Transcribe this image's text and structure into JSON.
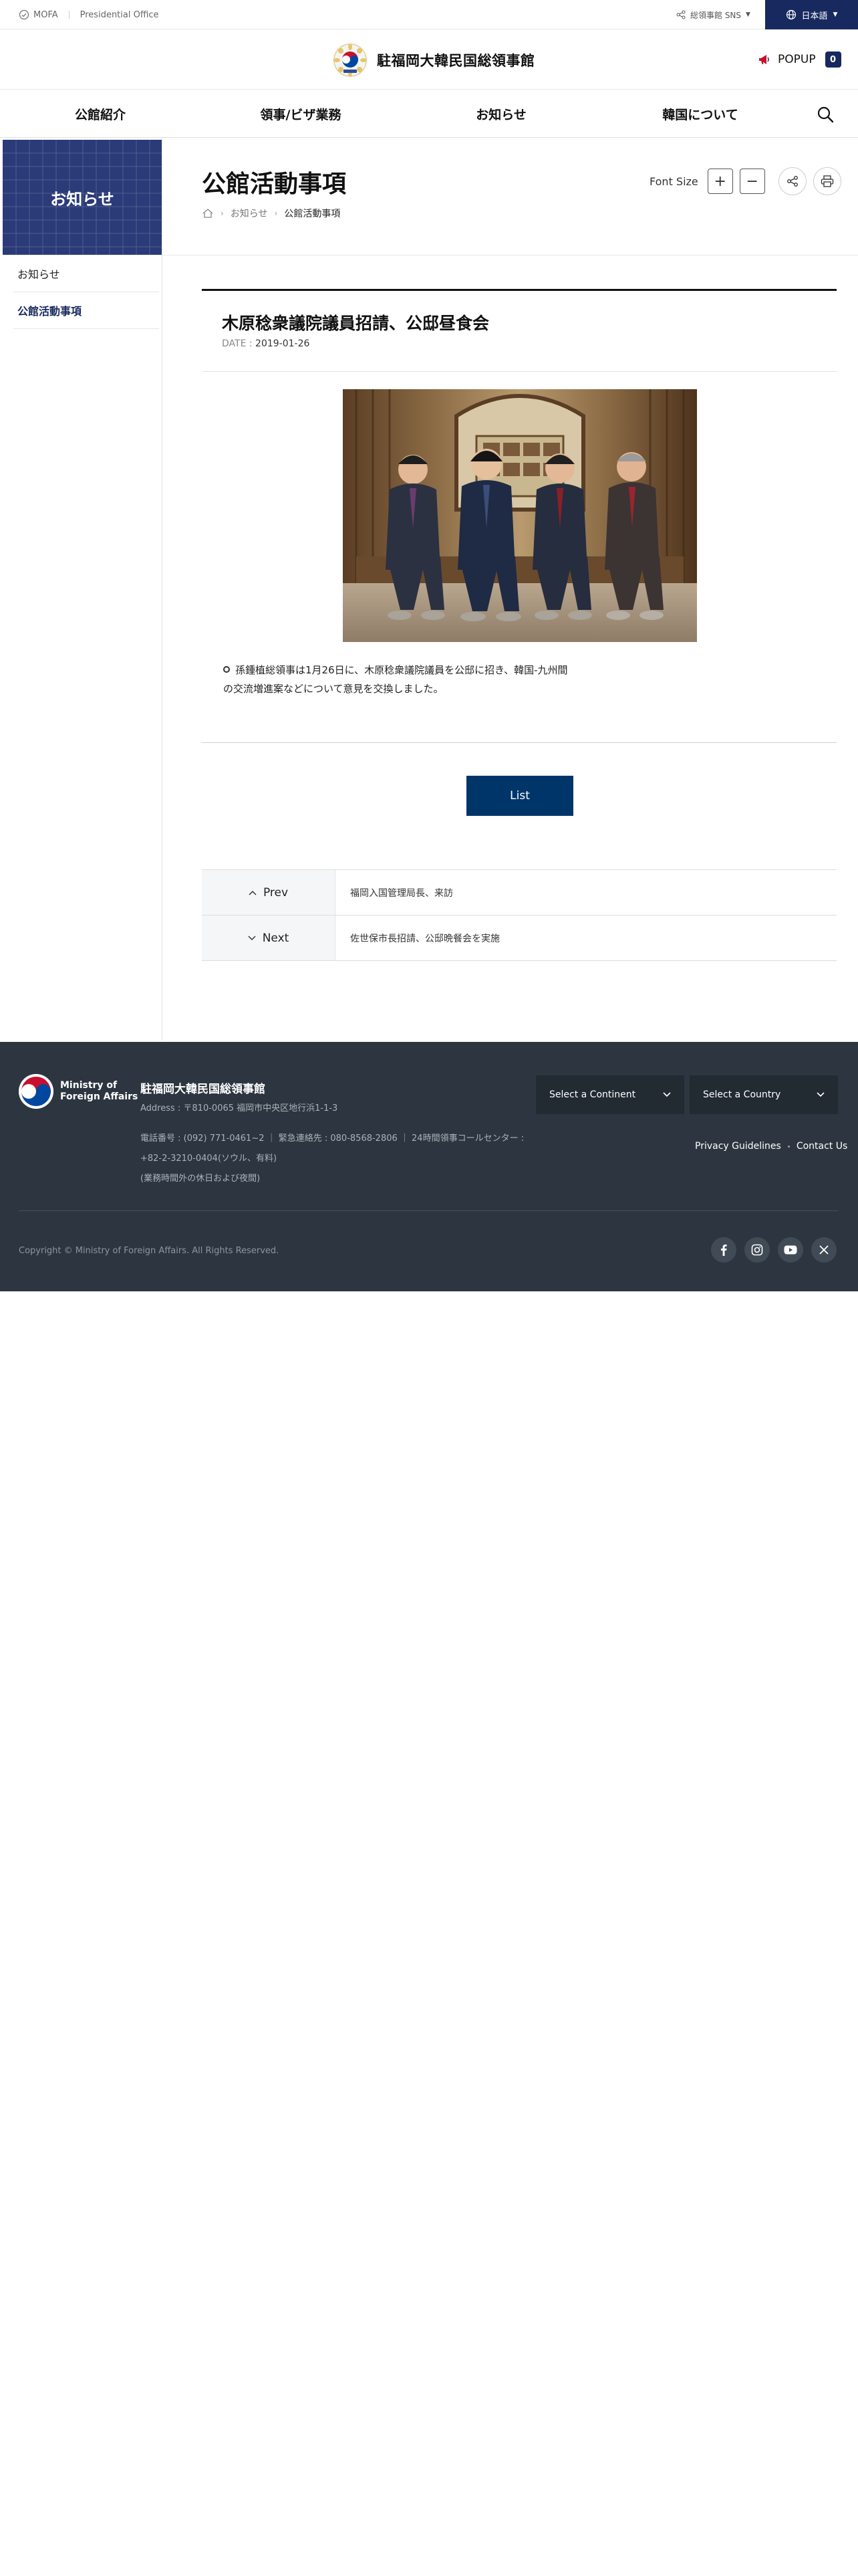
{
  "topbar": {
    "mofa_label": "MOFA",
    "presidential_label": "Presidential Office",
    "sns_label": "総領事館 SNS",
    "lang_label": "日本語"
  },
  "header": {
    "site_title": "駐福岡大韓民国総領事館",
    "popup_label": "POPUP",
    "popup_count": "0"
  },
  "gnb": {
    "items": [
      "公館紹介",
      "領事/ビザ業務",
      "お知らせ",
      "韓国について"
    ]
  },
  "sidebar": {
    "heading": "お知らせ",
    "items": [
      {
        "label": "お知らせ",
        "active": false
      },
      {
        "label": "公館活動事項",
        "active": true
      }
    ]
  },
  "page": {
    "title": "公館活動事項",
    "breadcrumb": [
      "お知らせ",
      "公館活動事項"
    ],
    "font_size_label": "Font Size",
    "plus_symbol": "+",
    "minus_symbol": "−"
  },
  "article": {
    "title": "木原稔衆議院議員招請、公邸昼食会",
    "date_label": "DATE :",
    "date_value": "2019-01-26",
    "body": "孫鍾植総領事は1月26日に、木原稔衆議院議員を公邸に招き、韓国-九州間の交流増進案などについて意見を交換しました。",
    "list_button": "List"
  },
  "prevnext": {
    "prev_label": "Prev",
    "prev_title": "福岡入国管理局長、来訪",
    "next_label": "Next",
    "next_title": "佐世保市長招請、公邸晩餐会を実施"
  },
  "footer": {
    "mfa_logo_line1": "Ministry of",
    "mfa_logo_line2": "Foreign Affairs",
    "name": "駐福岡大韓民国総領事館",
    "address": "Address : 〒810-0065 福岡市中央区地行浜1-1-3",
    "tel_line1": "電話番号 : (092) 771-0461~2 ｜ 緊急連絡先 : 080-8568-2806 ｜ 24時間領事コールセンター :",
    "tel_line2": "+82-2-3210-0404(ソウル、有料)",
    "tel_line3": "(業務時間外の休日および夜間)",
    "select_continent": "Select a Continent",
    "select_country": "Select a Country",
    "privacy": "Privacy Guidelines",
    "contact": "Contact Us",
    "copyright": "Copyright © Ministry of Foreign Affairs. All Rights Reserved."
  },
  "colors": {
    "brand_navy": "#17295e",
    "list_button": "#003569",
    "footer_bg": "#2d3640"
  },
  "icons": [
    "check-circle-icon",
    "share-icon",
    "globe-icon",
    "megaphone-icon",
    "search-icon",
    "home-icon",
    "plus-icon",
    "minus-icon",
    "print-icon",
    "chevron-up-icon",
    "chevron-down-icon",
    "facebook-icon",
    "instagram-icon",
    "youtube-icon",
    "x-icon"
  ]
}
